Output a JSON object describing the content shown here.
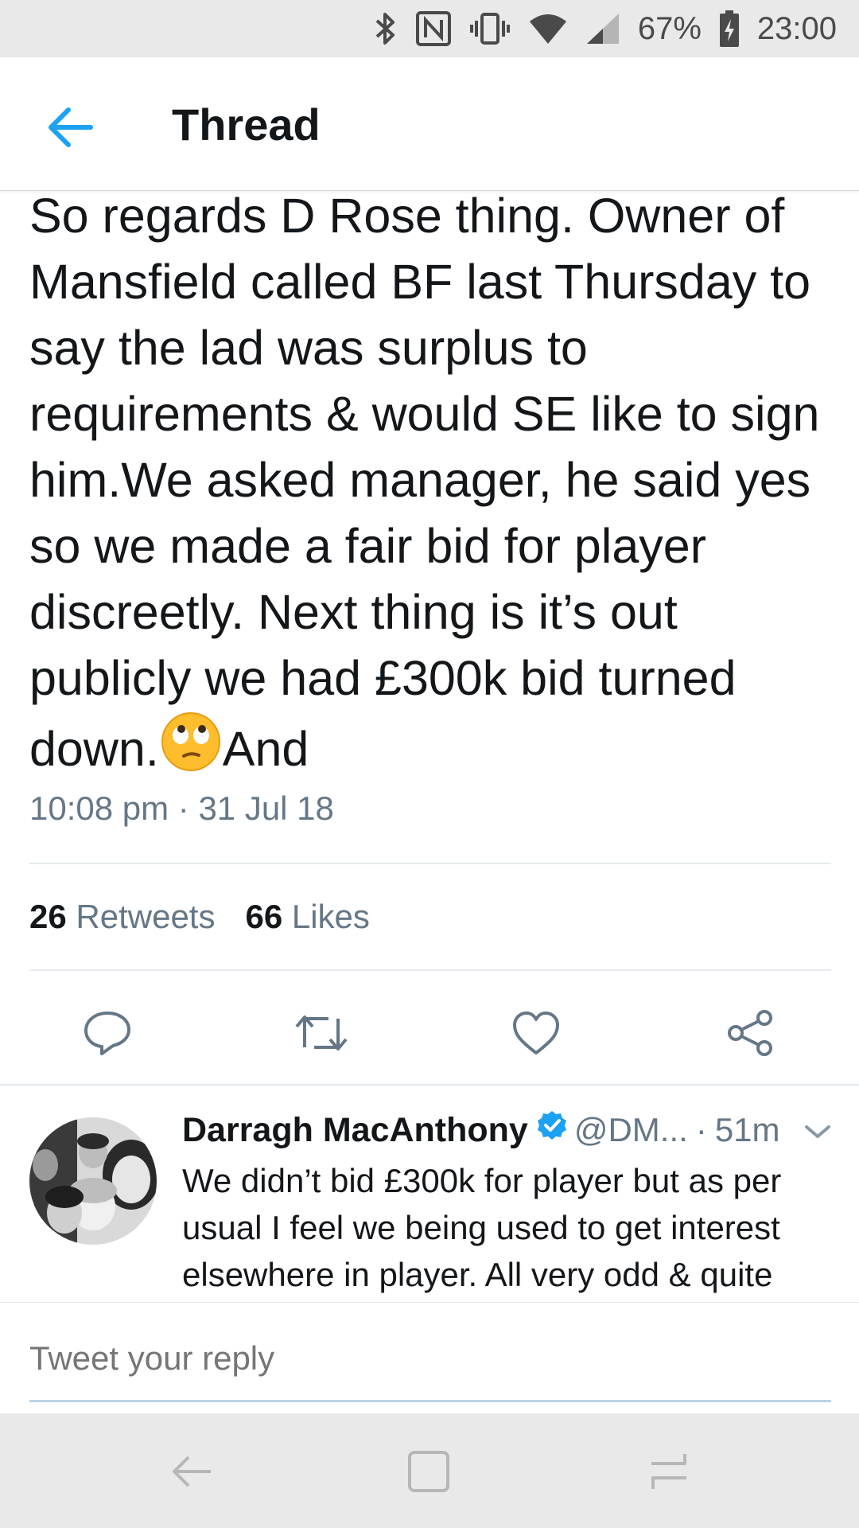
{
  "status_bar": {
    "battery": "67%",
    "time": "23:00",
    "icons": [
      "bluetooth-icon",
      "nfc-icon",
      "vibrate-icon",
      "wifi-icon",
      "signal-icon",
      "battery-icon"
    ]
  },
  "header": {
    "title": "Thread",
    "back_icon": "back-arrow-icon"
  },
  "tweet": {
    "text_before_emoji": "So regards D Rose thing. Owner of Mansfield called BF last Thursday to say the lad was surplus to requirements & would SE like to sign him.We asked manager, he said yes so we made a fair bid for player discreetly. Next thing is it’s out publicly we had £300k bid turned down.",
    "emoji": "eye-roll-emoji",
    "text_after_emoji": "And",
    "timestamp": "10:08 pm · 31 Jul 18",
    "retweets_count": "26",
    "retweets_label": "Retweets",
    "likes_count": "66",
    "likes_label": "Likes"
  },
  "actions": [
    "reply-icon",
    "retweet-icon",
    "like-icon",
    "share-icon"
  ],
  "reply": {
    "name": "Darragh MacAnthony",
    "handle": "@DM...",
    "separator": "·",
    "time": "51m",
    "text": "We didn’t bid £300k for player but as per usual I feel we being used to get interest elsewhere in player. All very odd & quite"
  },
  "reply_box": {
    "placeholder": "Tweet your reply"
  },
  "colors": {
    "accent": "#1da1f2",
    "secondary_text": "#657786",
    "primary_text": "#14171a"
  }
}
